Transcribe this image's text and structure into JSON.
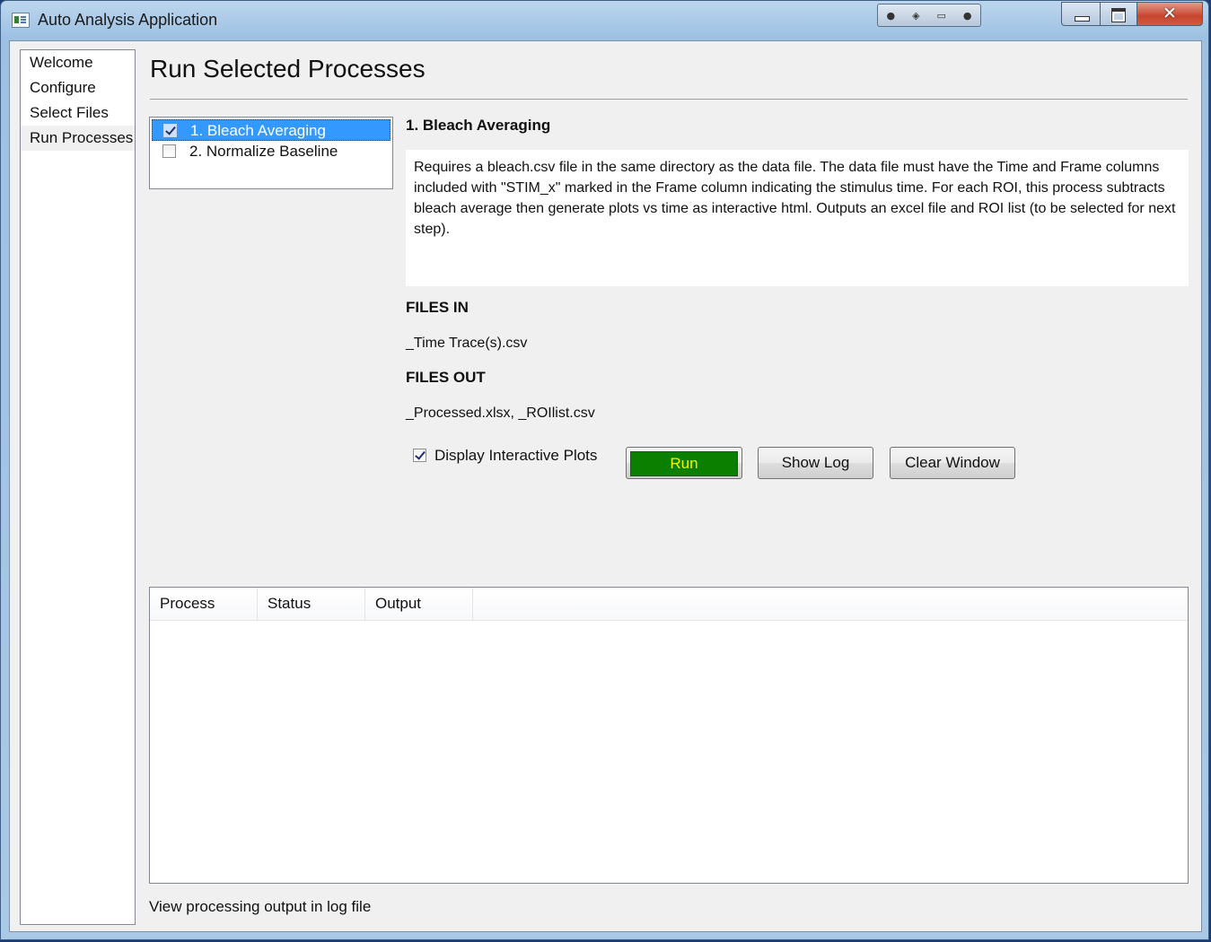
{
  "window": {
    "title": "Auto Analysis Application",
    "close_glyph": "✕"
  },
  "nav": {
    "items": [
      {
        "label": "Welcome"
      },
      {
        "label": "Configure"
      },
      {
        "label": "Select Files"
      },
      {
        "label": "Run Processes",
        "selected": true
      }
    ]
  },
  "page": {
    "title": "Run Selected Processes"
  },
  "processes": [
    {
      "label": "1. Bleach Averaging",
      "checked": true,
      "selected": true
    },
    {
      "label": "2. Normalize Baseline",
      "checked": false,
      "selected": false
    }
  ],
  "detail": {
    "heading": "1. Bleach Averaging",
    "description": "Requires a bleach.csv file in the same directory as the data file. The data file must have the Time and Frame columns included with \"STIM_x\" marked in the Frame column indicating the stimulus time. For each ROI, this process subtracts bleach average then generate plots vs time as interactive html. Outputs an excel file and ROI list (to be selected for next step).",
    "files_in_label": "FILES IN",
    "files_in": "_Time Trace(s).csv",
    "files_out_label": "FILES OUT",
    "files_out": "_Processed.xlsx, _ROIlist.csv"
  },
  "controls": {
    "display_plots_label": "Display Interactive Plots",
    "display_plots_checked": true,
    "run_label": "Run",
    "show_log_label": "Show Log",
    "clear_window_label": "Clear Window"
  },
  "table": {
    "columns": [
      "Process",
      "Status",
      "Output"
    ],
    "rows": []
  },
  "footer": {
    "text": "View processing output in log file"
  },
  "colors": {
    "run_button_bg": "#0a7f00",
    "run_button_text": "#f4f400",
    "selection": "#3399ff"
  }
}
